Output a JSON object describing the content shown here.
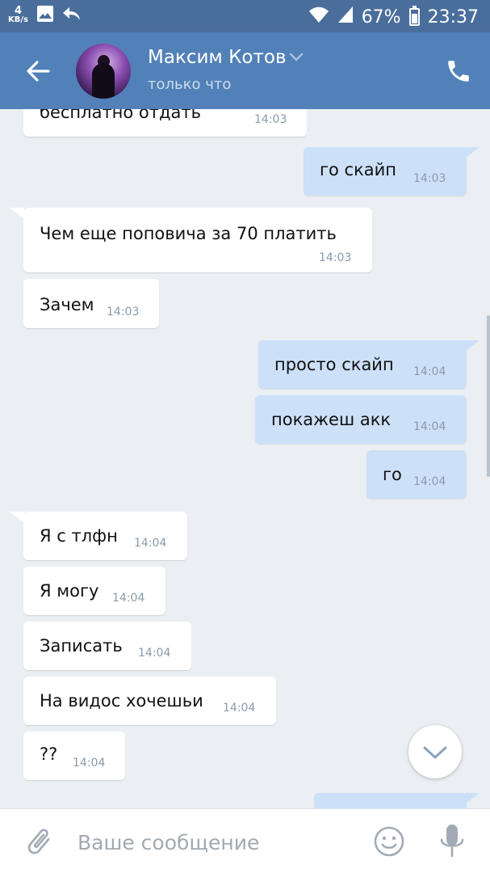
{
  "status_bar": {
    "speed_value": "4",
    "speed_unit": "KB/s",
    "battery": "67%",
    "time": "23:37",
    "icons": [
      "image-icon",
      "reply-icon",
      "wifi-icon",
      "signal-icon",
      "battery-icon"
    ],
    "battery_level": 0.67
  },
  "header": {
    "name": "Максим Котов",
    "status": "только что",
    "icons": [
      "back-arrow-icon",
      "chevron-down-icon",
      "phone-icon"
    ]
  },
  "messages": [
    {
      "dir": "in",
      "text": "бесплатно отдать",
      "time": "14:03"
    },
    {
      "dir": "out",
      "text": "го скайп",
      "time": "14:03"
    },
    {
      "dir": "in",
      "text": "Чем еще поповича за 70 платить",
      "time": "14:03"
    },
    {
      "dir": "in",
      "text": "Зачем",
      "time": "14:03"
    },
    {
      "dir": "out",
      "text": "просто скайп",
      "time": "14:04"
    },
    {
      "dir": "out",
      "text": "покажеш акк",
      "time": "14:04"
    },
    {
      "dir": "out",
      "text": "го",
      "time": "14:04"
    },
    {
      "dir": "in",
      "text": "Я с тлфн",
      "time": "14:04"
    },
    {
      "dir": "in",
      "text": "Я могу",
      "time": "14:04"
    },
    {
      "dir": "in",
      "text": "Записать",
      "time": "14:04"
    },
    {
      "dir": "in",
      "text": "На видос хочешьи",
      "time": "14:04"
    },
    {
      "dir": "in",
      "text": "??",
      "time": "14:04"
    }
  ],
  "input": {
    "placeholder": "Ваше сообщение",
    "value": ""
  },
  "colors": {
    "status_bar": "#4a6e9b",
    "header": "#5181b8",
    "background": "#ebeff3",
    "incoming_bubble": "#ffffff",
    "outgoing_bubble": "#cce0f7",
    "time_text": "#8a9aab"
  }
}
